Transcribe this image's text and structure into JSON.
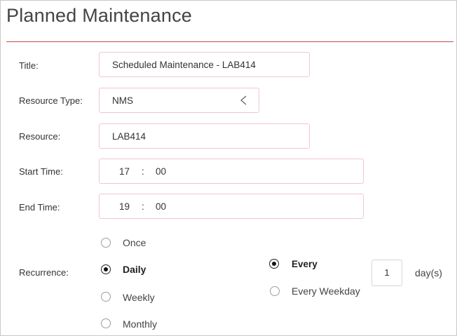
{
  "header": {
    "title": "Planned Maintenance"
  },
  "form": {
    "title_label": "Title:",
    "title_value": "Scheduled Maintenance - LAB414",
    "resource_type_label": "Resource Type:",
    "resource_type_value": "NMS",
    "resource_label": "Resource:",
    "resource_value": "LAB414",
    "start_label": "Start Time:",
    "start_hour": "17",
    "start_minute": "00",
    "end_label": "End Time:",
    "end_hour": "19",
    "end_minute": "00",
    "time_separator": ":",
    "recurrence_label": "Recurrence:"
  },
  "recurrence": {
    "options": [
      "Once",
      "Daily",
      "Weekly",
      "Monthly"
    ],
    "selected": "Daily",
    "mode_options": [
      "Every",
      "Every Weekday"
    ],
    "mode_selected": "Every",
    "interval": "1",
    "interval_unit": "day(s)"
  }
}
